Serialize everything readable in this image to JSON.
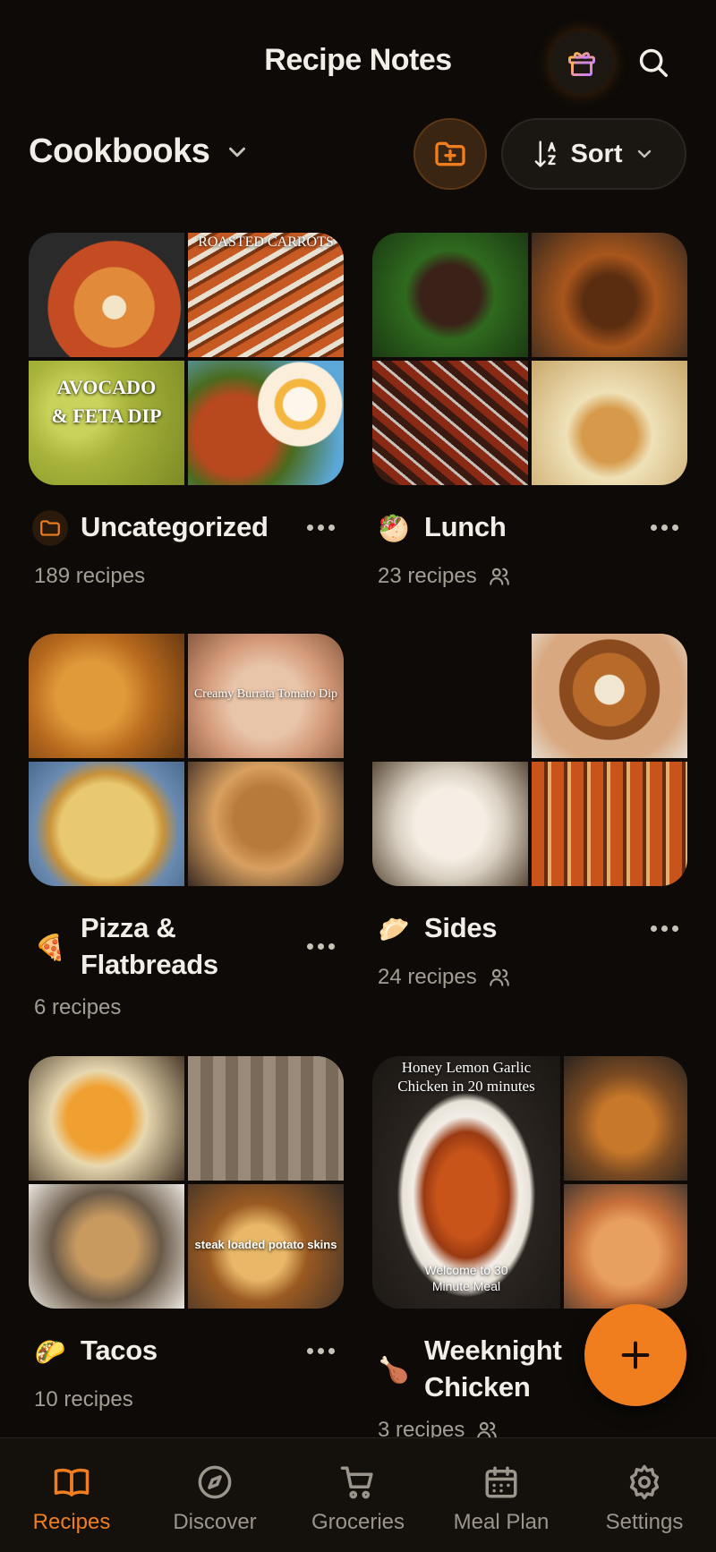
{
  "header": {
    "title": "Recipe Notes"
  },
  "section": {
    "title": "Cookbooks",
    "sort_label": "Sort"
  },
  "colors": {
    "accent": "#f07e1e",
    "background": "#0d0a07",
    "muted": "#a49d94"
  },
  "cookbooks": [
    {
      "name": "Uncategorized",
      "icon": "folder-icon",
      "count": "189 recipes",
      "shared": false,
      "captions": [
        "",
        "ROASTED CARROTS",
        "AVOCADO & FETA DIP",
        ""
      ]
    },
    {
      "name": "Lunch",
      "icon": "🥙",
      "count": "23 recipes",
      "shared": true,
      "captions": [
        "",
        "",
        "",
        ""
      ]
    },
    {
      "name": "Pizza & Flatbreads",
      "icon": "🍕",
      "count": "6 recipes",
      "shared": false,
      "captions": [
        "",
        "Creamy Burrata Tomato Dip",
        "",
        ""
      ]
    },
    {
      "name": "Sides",
      "icon": "🥟",
      "count": "24 recipes",
      "shared": true,
      "captions": [
        "",
        "",
        "",
        ""
      ]
    },
    {
      "name": "Tacos",
      "icon": "🌮",
      "count": "10 recipes",
      "shared": false,
      "captions": [
        "",
        "",
        "",
        "steak loaded potato skins"
      ]
    },
    {
      "name": "Weeknight Chicken",
      "icon": "🍗",
      "count": "3 recipes",
      "shared": true,
      "captions": [
        "Honey Lemon Garlic Chicken in 20 minutes",
        "",
        "",
        "",
        "Welcome to 30 Minute Meal"
      ]
    }
  ],
  "nav": [
    {
      "label": "Recipes",
      "icon": "book-icon",
      "active": true
    },
    {
      "label": "Discover",
      "icon": "compass-icon",
      "active": false
    },
    {
      "label": "Groceries",
      "icon": "cart-icon",
      "active": false
    },
    {
      "label": "Meal Plan",
      "icon": "calendar-icon",
      "active": false
    },
    {
      "label": "Settings",
      "icon": "gear-icon",
      "active": false
    }
  ]
}
